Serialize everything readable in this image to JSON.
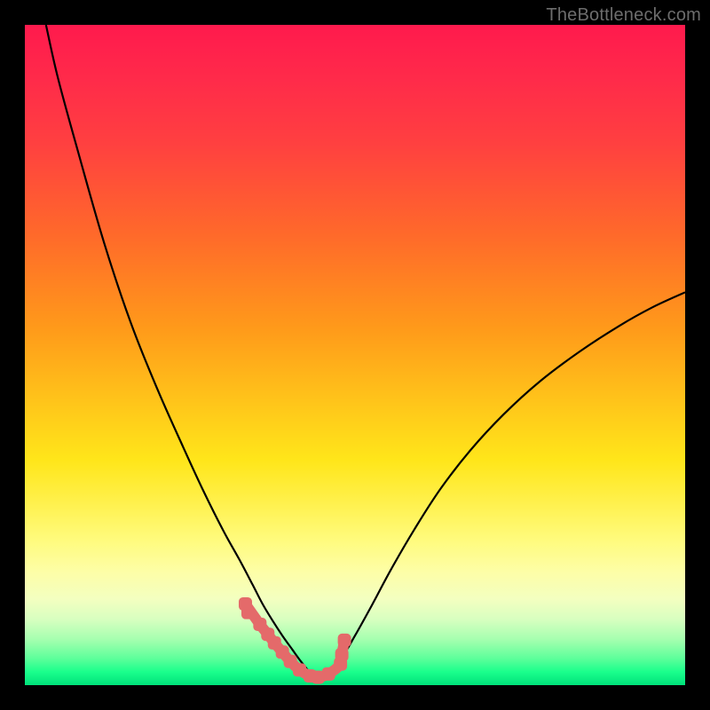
{
  "watermark": "TheBottleneck.com",
  "chart_data": {
    "type": "line",
    "title": "",
    "xlabel": "",
    "ylabel": "",
    "xlim": [
      0,
      100
    ],
    "ylim": [
      0,
      100
    ],
    "grid": false,
    "legend": false,
    "series": [
      {
        "name": "left-branch",
        "x": [
          3.2,
          5,
          8,
          12,
          16,
          20,
          24,
          27,
          30,
          32.5,
          34.5,
          36,
          37.5,
          39,
          40.5,
          41.8,
          43
        ],
        "y": [
          100,
          92,
          81,
          67,
          55,
          45,
          36,
          29.5,
          23.5,
          19,
          15.2,
          12.3,
          9.8,
          7.5,
          5.4,
          3.6,
          2.1
        ],
        "stroke": "#000000",
        "stroke_width": 2.2
      },
      {
        "name": "right-branch",
        "x": [
          46,
          48,
          50,
          52.5,
          55.5,
          59,
          63,
          67.5,
          72.5,
          78,
          84,
          90,
          95,
          100
        ],
        "y": [
          2.1,
          4.2,
          7.5,
          12,
          17.6,
          23.6,
          29.8,
          35.6,
          41,
          46,
          50.5,
          54.4,
          57.2,
          59.5
        ],
        "stroke": "#000000",
        "stroke_width": 2.2
      },
      {
        "name": "valley-floor",
        "x": [
          33.4,
          35.6,
          36.8,
          37.8,
          39.0,
          40.2,
          41.6,
          43.2,
          44.4,
          46.0,
          47.8,
          48.0,
          48.4
        ],
        "y": [
          12.3,
          9.2,
          7.7,
          6.4,
          5.0,
          3.6,
          2.3,
          1.4,
          1.2,
          1.7,
          3.2,
          4.6,
          6.8
        ],
        "stroke": "#e46a6a",
        "stroke_width": 12,
        "linecap": "round"
      },
      {
        "name": "valley-dots",
        "type": "scatter",
        "points": [
          {
            "x": 33.4,
            "y": 12.3
          },
          {
            "x": 33.8,
            "y": 11.0
          },
          {
            "x": 35.6,
            "y": 9.2
          },
          {
            "x": 36.8,
            "y": 7.7
          },
          {
            "x": 37.8,
            "y": 6.4
          },
          {
            "x": 39.0,
            "y": 5.0
          },
          {
            "x": 40.2,
            "y": 3.6
          },
          {
            "x": 41.6,
            "y": 2.3
          },
          {
            "x": 43.2,
            "y": 1.4
          },
          {
            "x": 44.4,
            "y": 1.2
          },
          {
            "x": 46.0,
            "y": 1.7
          },
          {
            "x": 47.8,
            "y": 3.2
          },
          {
            "x": 48.0,
            "y": 4.6
          },
          {
            "x": 48.4,
            "y": 6.8
          }
        ],
        "marker": "rounded-square",
        "marker_size": 15,
        "fill": "#e46a6a"
      }
    ],
    "background_gradient": {
      "direction": "top-to-bottom",
      "stops": [
        {
          "pos": 0,
          "color": "#ff1a4d"
        },
        {
          "pos": 50,
          "color": "#ffc81a"
        },
        {
          "pos": 85,
          "color": "#fdfea8"
        },
        {
          "pos": 100,
          "color": "#00e17a"
        }
      ]
    }
  }
}
